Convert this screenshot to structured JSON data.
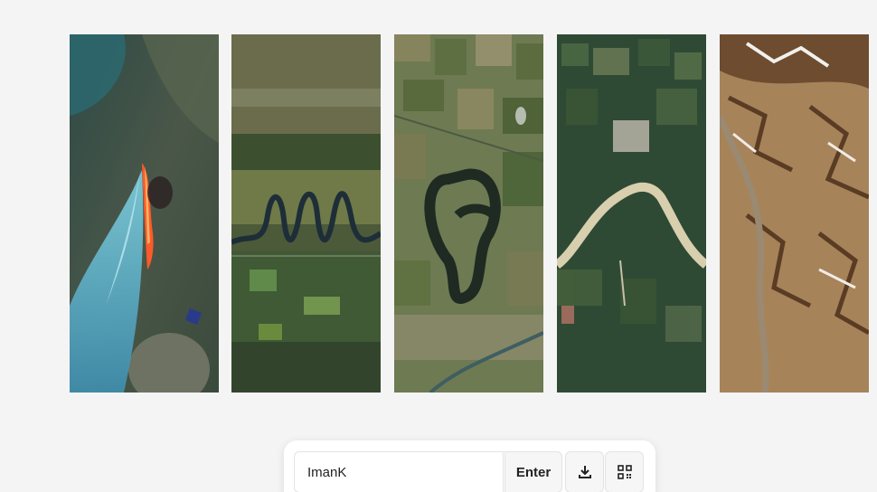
{
  "gallery": {
    "tiles": [
      {
        "icon": "wildfire-satellite-image"
      },
      {
        "icon": "meandering-river-valley-satellite-image"
      },
      {
        "icon": "oxbow-lake-farmland-satellite-image"
      },
      {
        "icon": "river-through-farmland-satellite-image"
      },
      {
        "icon": "mountain-ridges-satellite-image"
      }
    ]
  },
  "name_bar": {
    "input_value": "ImanK",
    "enter_label": "Enter",
    "download_icon": "download-icon",
    "qr_icon": "qr-code-icon"
  }
}
